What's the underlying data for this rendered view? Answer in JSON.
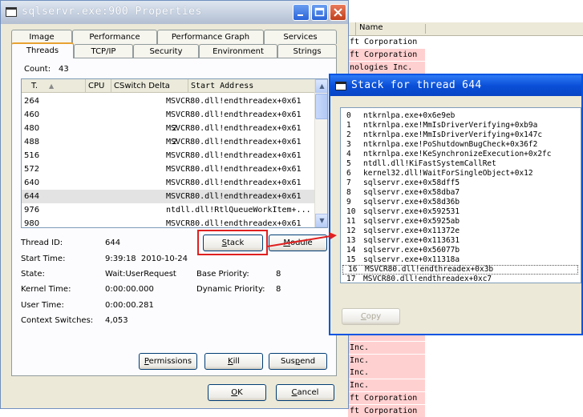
{
  "background_list": {
    "header": "Name",
    "rows": [
      {
        "text": "ft Corporation",
        "pink": false
      },
      {
        "text": "ft Corporation",
        "pink": true
      },
      {
        "text": "nologies Inc.",
        "pink": true
      },
      {
        "text": "",
        "pink": true
      },
      {
        "text": "",
        "pink": true
      },
      {
        "text": "",
        "pink": true
      },
      {
        "text": "",
        "pink": true
      },
      {
        "text": "",
        "pink": true
      },
      {
        "text": "",
        "pink": true
      },
      {
        "text": "",
        "pink": true
      },
      {
        "text": "",
        "pink": true
      },
      {
        "text": "",
        "pink": true
      },
      {
        "text": "",
        "pink": true
      },
      {
        "text": "",
        "pink": true
      },
      {
        "text": "",
        "pink": true
      },
      {
        "text": "",
        "pink": true
      },
      {
        "text": "",
        "pink": true
      },
      {
        "text": "",
        "pink": true
      },
      {
        "text": "",
        "pink": true
      },
      {
        "text": "",
        "pink": true
      },
      {
        "text": "",
        "pink": true
      },
      {
        "text": "",
        "pink": true
      },
      {
        "text": "",
        "pink": true
      },
      {
        "text": "",
        "pink": true
      },
      {
        "text": "Inc.",
        "pink": true
      },
      {
        "text": "Inc.",
        "pink": true
      },
      {
        "text": "Inc.",
        "pink": true
      },
      {
        "text": "Inc.",
        "pink": true
      },
      {
        "text": "ft Corporation",
        "pink": true
      },
      {
        "text": "ft Corporation",
        "pink": true
      }
    ]
  },
  "main_window": {
    "title": "sqlservr.exe:900 Properties",
    "tabs_row1": [
      "Image",
      "Performance",
      "Performance Graph",
      "Services"
    ],
    "tabs_row2": [
      "Threads",
      "TCP/IP",
      "Security",
      "Environment",
      "Strings"
    ],
    "active_tab": "Threads",
    "count_label": "Count:",
    "count_value": "43",
    "columns": [
      "T.",
      "CPU",
      "CSwitch Delta",
      "Start Address"
    ],
    "threads": [
      {
        "tid": "264",
        "cpu": "",
        "delta": "",
        "address": "MSVCR80.dll!endthreadex+0x61",
        "selected": false
      },
      {
        "tid": "460",
        "cpu": "",
        "delta": "",
        "address": "MSVCR80.dll!endthreadex+0x61",
        "selected": false
      },
      {
        "tid": "480",
        "cpu": "",
        "delta": "2",
        "address": "MSVCR80.dll!endthreadex+0x61",
        "selected": false
      },
      {
        "tid": "488",
        "cpu": "",
        "delta": "2",
        "address": "MSVCR80.dll!endthreadex+0x61",
        "selected": false
      },
      {
        "tid": "516",
        "cpu": "",
        "delta": "",
        "address": "MSVCR80.dll!endthreadex+0x61",
        "selected": false
      },
      {
        "tid": "572",
        "cpu": "",
        "delta": "",
        "address": "MSVCR80.dll!endthreadex+0x61",
        "selected": false
      },
      {
        "tid": "640",
        "cpu": "",
        "delta": "",
        "address": "MSVCR80.dll!endthreadex+0x61",
        "selected": false
      },
      {
        "tid": "644",
        "cpu": "",
        "delta": "",
        "address": "MSVCR80.dll!endthreadex+0x61",
        "selected": true
      },
      {
        "tid": "976",
        "cpu": "",
        "delta": "",
        "address": "ntdll.dll!RtlQueueWorkItem+...",
        "selected": false
      },
      {
        "tid": "980",
        "cpu": "",
        "delta": "",
        "address": "MSVCR80.dll!endthreadex+0x61",
        "selected": false
      }
    ],
    "details": {
      "thread_id_label": "Thread ID:",
      "thread_id": "644",
      "start_time_label": "Start Time:",
      "start_time": "9:39:18  2010-10-24",
      "state_label": "State:",
      "state": "Wait:UserRequest",
      "base_priority_label": "Base Priority:",
      "base_priority": "8",
      "kernel_time_label": "Kernel Time:",
      "kernel_time": "0:00:00.000",
      "dynamic_priority_label": "Dynamic Priority:",
      "dynamic_priority": "8",
      "user_time_label": "User Time:",
      "user_time": "0:00:00.281",
      "context_switches_label": "Context Switches:",
      "context_switches": "4,053"
    },
    "buttons": {
      "stack_pre": "",
      "stack_u": "S",
      "stack_post": "tack",
      "module_pre": "",
      "module_u": "M",
      "module_post": "odule",
      "permissions_pre": "",
      "permissions_u": "P",
      "permissions_post": "ermissions",
      "kill_pre": "",
      "kill_u": "K",
      "kill_post": "ill",
      "suspend_pre": "Sus",
      "suspend_u": "p",
      "suspend_post": "end",
      "ok_pre": "",
      "ok_u": "O",
      "ok_post": "K",
      "cancel_pre": "",
      "cancel_u": "C",
      "cancel_post": "ancel"
    }
  },
  "stack_window": {
    "title": "Stack for thread 644",
    "frames": [
      {
        "n": "0",
        "f": "ntkrnlpa.exe+0x6e9eb"
      },
      {
        "n": "1",
        "f": "ntkrnlpa.exe!MmIsDriverVerifying+0xb9a"
      },
      {
        "n": "2",
        "f": "ntkrnlpa.exe!MmIsDriverVerifying+0x147c"
      },
      {
        "n": "3",
        "f": "ntkrnlpa.exe!PoShutdownBugCheck+0x36f2"
      },
      {
        "n": "4",
        "f": "ntkrnlpa.exe!KeSynchronizeExecution+0x2fc"
      },
      {
        "n": "5",
        "f": "ntdll.dll!KiFastSystemCallRet"
      },
      {
        "n": "6",
        "f": "kernel32.dll!WaitForSingleObject+0x12"
      },
      {
        "n": "7",
        "f": "sqlservr.exe+0x58dff5"
      },
      {
        "n": "8",
        "f": "sqlservr.exe+0x58dba7"
      },
      {
        "n": "9",
        "f": "sqlservr.exe+0x58d36b"
      },
      {
        "n": "10",
        "f": "sqlservr.exe+0x592531"
      },
      {
        "n": "11",
        "f": "sqlservr.exe+0x5925ab"
      },
      {
        "n": "12",
        "f": "sqlservr.exe+0x11372e"
      },
      {
        "n": "13",
        "f": "sqlservr.exe+0x113631"
      },
      {
        "n": "14",
        "f": "sqlservr.exe+0x56077b"
      },
      {
        "n": "15",
        "f": "sqlservr.exe+0x11318a"
      },
      {
        "n": "16",
        "f": "MSVCR80.dll!endthreadex+0x3b"
      },
      {
        "n": "17",
        "f": "MSVCR80.dll!endthreadex+0xc7"
      }
    ],
    "selected_frame": 16,
    "copy_pre": "",
    "copy_u": "C",
    "copy_post": "opy"
  },
  "colors": {
    "annotation_red": "#e02020",
    "highlight_pink": "#ffd0d0"
  }
}
